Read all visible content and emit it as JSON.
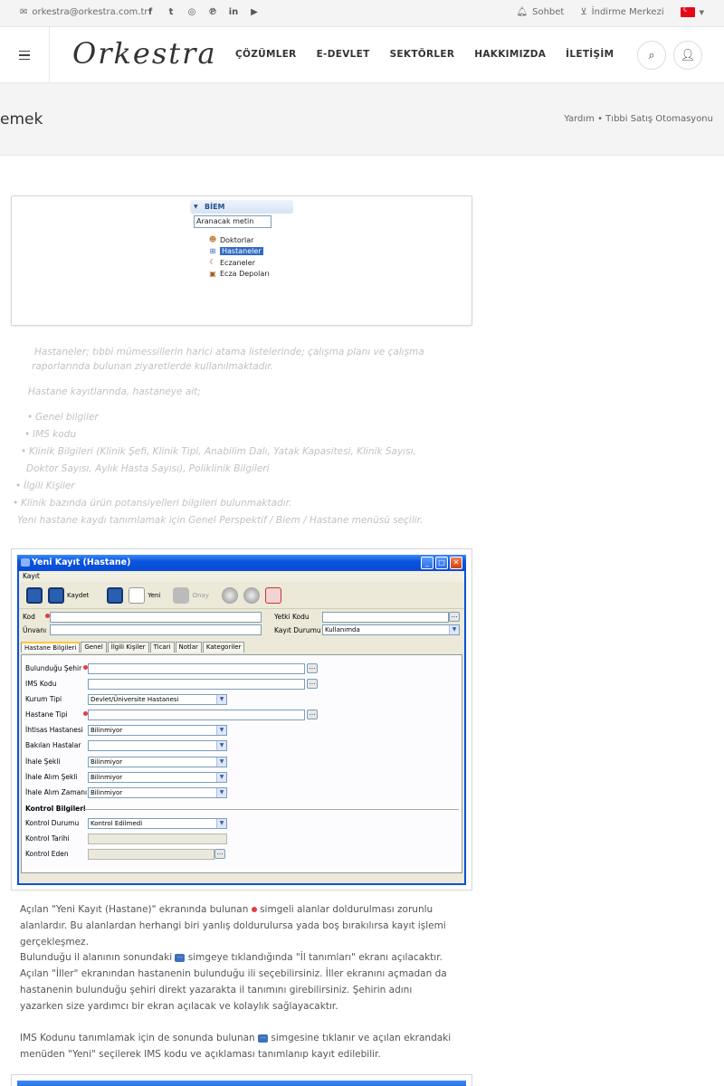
{
  "topbar": {
    "email": "orkestra@orkestra.com.tr",
    "social": [
      "f",
      "t",
      "ig",
      "p",
      "in",
      "yt"
    ],
    "chat": "Sohbet",
    "download": "İndirme Merkezi",
    "lang_flag": "TR"
  },
  "header": {
    "logo": "Orkestra",
    "nav": [
      "ÇÖZÜMLER",
      "E-DEVLET",
      "SEKTÖRLER",
      "HAKKIMIZDA",
      "İLETİŞİM"
    ]
  },
  "page": {
    "title": "emek",
    "breadcrumb": "Yardım • Tıbbi Satış Otomasyonu"
  },
  "biem": {
    "header": "BİEM",
    "search": "Aranacak metin",
    "items": [
      "Doktorlar",
      "Hastaneler",
      "Eczaneler",
      "Ecza Depoları"
    ]
  },
  "faded": {
    "p1": "Hastaneler; tıbbi mümessillerin harici atama listelerinde; çalışma planı ve çalışma",
    "p1b": "raporlarında bulunan ziyaretlerde kullanılmaktadır.",
    "p2": "Hastane  kayıtlarında, hastaneye ait;",
    "b1": "Genel bilgiler",
    "b2": "IMS kodu",
    "b3": "Klinik  Bilgileri  (Klinik  Şefi,  Klinik  Tipi,  Anabilim  Dalı,  Yatak  Kapasitesi,  Klinik  Sayısı,",
    "b3b": "Doktor Sayısı, Aylık Hasta Sayısı), Poliklinik Bilgileri",
    "b4": "İlgili Kişiler",
    "b5": "Klinik bazında ürün potansiyelleri bilgileri bulunmaktadır.",
    "p3": "Yeni hastane kaydı tanımlamak için Genel Perspektif / Biem / Hastane menüsü seçilir."
  },
  "window": {
    "title": "Yeni Kayıt (Hastane)",
    "menu": "Kayıt",
    "toolbar": {
      "save": "Kaydet",
      "new": "Yeni",
      "approve": "Onay"
    },
    "fields": {
      "kod": "Kod",
      "unvan": "Ünvanı",
      "yetki": "Yetki Kodu",
      "durum": "Kayıt Durumu",
      "durum_val": "Kullanımda"
    },
    "tabs": [
      "Hastane Bilgileri",
      "Genel",
      "İlgili Kişiler",
      "Ticari",
      "Notlar",
      "Kategoriler"
    ],
    "rows": [
      {
        "label": "Bulunduğu Şehir",
        "value": ""
      },
      {
        "label": "IMS Kodu",
        "value": ""
      },
      {
        "label": "Kurum Tipi",
        "value": "Devlet/Üniversite Hastanesi"
      },
      {
        "label": "Hastane Tipi",
        "value": ""
      },
      {
        "label": "İhtisas Hastanesi",
        "value": "Bilinmiyor"
      },
      {
        "label": "Bakılan Hastalar",
        "value": ""
      },
      {
        "label": "İhale Şekli",
        "value": "Bilinmiyor"
      },
      {
        "label": "İhale Alım Şekli",
        "value": "Bilinmiyor"
      },
      {
        "label": "İhale Alım Zamanı",
        "value": "Bilinmiyor"
      }
    ],
    "control_title": "Kontrol Bilgileri",
    "control": [
      {
        "label": "Kontrol Durumu",
        "value": "Kontrol Edilmedi"
      },
      {
        "label": "Kontrol Tarihi",
        "value": ""
      },
      {
        "label": "Kontrol Eden",
        "value": ""
      }
    ]
  },
  "body": {
    "p1a": "Açılan \"Yeni Kayıt (Hastane)\" ekranında bulunan ",
    "p1b": " simgeli alanlar doldurulması zorunlu",
    "p1c": "alanlardır. Bu alanlardan herhangi biri yanlış doldurulursa yada boş bırakılırsa kayıt işlemi",
    "p1d": "gerçekleşmez.",
    "p2a": "Bulunduğu il alanının sonundaki ",
    "p2b": " simgeye tıklandığında \"İl tanımları\" ekranı açılacaktır.",
    "p2c": "Açılan \"İller\" ekranından hastanenin bulunduğu ili seçebilirsiniz. İller ekranını açmadan da",
    "p2d": "hastanenin bulunduğu şehiri direkt yazarakta il tanımını girebilirsiniz. Şehirin adını",
    "p2e": "yazarken size yardımcı bir ekran açılacak ve kolaylık sağlayacaktır.",
    "p3a": "IMS Kodunu tanımlamak için de sonunda bulunan ",
    "p3b": " simgesine tıklanır ve açılan ekrandaki",
    "p3c": "menüden \"Yeni\" seçilerek IMS kodu ve açıklaması tanımlanıp kayıt edilebilir."
  },
  "colors": {
    "accent": "#0a54e0",
    "required": "#e04040"
  }
}
